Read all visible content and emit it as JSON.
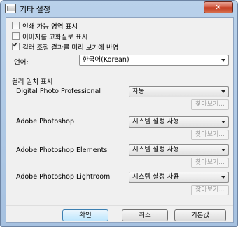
{
  "window": {
    "title": "기타 설정",
    "close_label": "✕"
  },
  "options": [
    {
      "label": "인쇄 가능 영역 표시",
      "checked": false
    },
    {
      "label": "이미지를 고화질로 표시",
      "checked": false
    },
    {
      "label": "컬러 조절 결과를 미리 보기에 반영",
      "checked": true
    }
  ],
  "language": {
    "label": "언어:",
    "value": "한국어(Korean)"
  },
  "color_match": {
    "heading": "컬러 일치 표시",
    "apps": [
      {
        "name": "Digital Photo Professional",
        "value": "자동",
        "browse_label": "찾아보기..."
      },
      {
        "name": "Adobe Photoshop",
        "value": "시스템 설정 사용",
        "browse_label": "찾아보기..."
      },
      {
        "name": "Adobe Photoshop Elements",
        "value": "시스템 설정 사용",
        "browse_label": "찾아보기..."
      },
      {
        "name": "Adobe Photoshop Lightroom",
        "value": "시스템 설정 사용",
        "browse_label": "찾아보기..."
      }
    ]
  },
  "buttons": {
    "ok": "확인",
    "cancel": "취소",
    "default": "기본값"
  }
}
